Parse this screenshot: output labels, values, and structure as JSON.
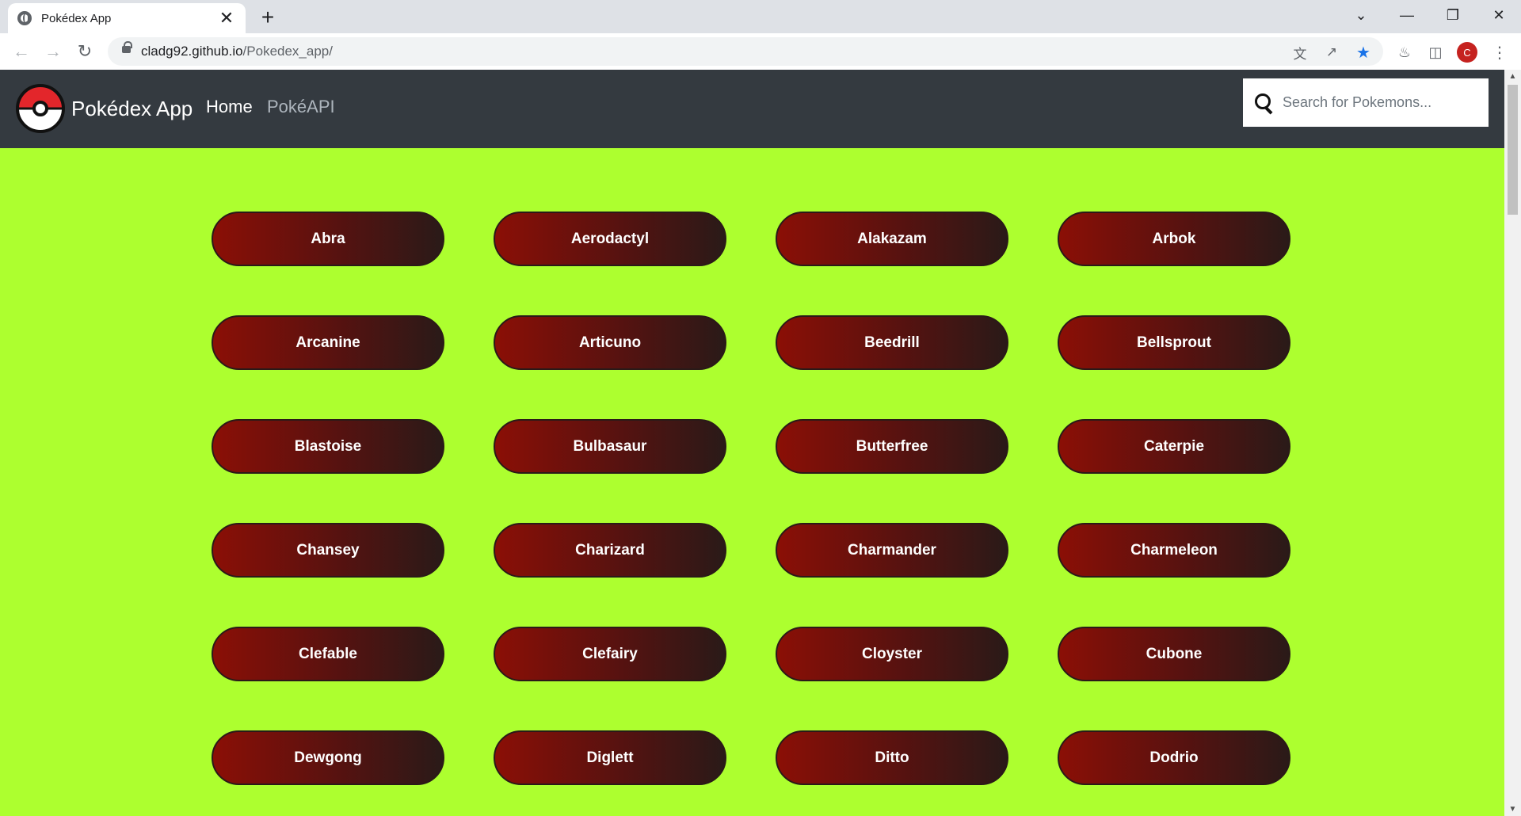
{
  "browser": {
    "tab_title": "Pokédex App",
    "tab_close": "✕",
    "new_tab": "+",
    "url_host": "cladg92.github.io",
    "url_path": "/Pokedex_app/",
    "profile_initial": "C",
    "controls": {
      "dropdown": "⌄",
      "minimize": "—",
      "restore": "❐",
      "close": "✕"
    },
    "icons": [
      "translate-icon",
      "share-icon",
      "bookmark-star-icon",
      "extensions-icon",
      "side-panel-icon",
      "menu-icon"
    ]
  },
  "navbar": {
    "brand": "Pokédex App",
    "links": [
      {
        "label": "Home",
        "active": true
      },
      {
        "label": "PokéAPI",
        "active": false
      }
    ],
    "search_placeholder": "Search for Pokemons..."
  },
  "pokemon": [
    "Abra",
    "Aerodactyl",
    "Alakazam",
    "Arbok",
    "Arcanine",
    "Articuno",
    "Beedrill",
    "Bellsprout",
    "Blastoise",
    "Bulbasaur",
    "Butterfree",
    "Caterpie",
    "Chansey",
    "Charizard",
    "Charmander",
    "Charmeleon",
    "Clefable",
    "Clefairy",
    "Cloyster",
    "Cubone",
    "Dewgong",
    "Diglett",
    "Ditto",
    "Dodrio"
  ],
  "colors": {
    "page_background": "#adff2f",
    "navbar_background": "#343a40",
    "button_gradient_start": "#8b0f06",
    "button_gradient_end": "#2a1a18",
    "link_active": "#ffffff",
    "link_inactive": "#adb5bd",
    "bookmark_star": "#1a73e8"
  }
}
